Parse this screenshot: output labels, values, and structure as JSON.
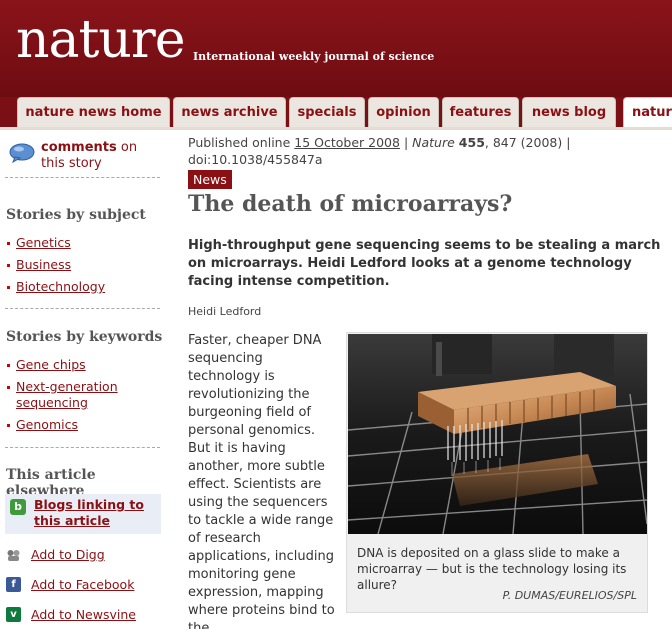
{
  "masthead": {
    "logo": "nature",
    "tagline": "International weekly journal of science"
  },
  "nav": {
    "tabs": [
      "nature news home",
      "news archive",
      "specials",
      "opinion",
      "features",
      "news blog",
      "natur"
    ]
  },
  "sidebar": {
    "comments": {
      "strong": "comments",
      "rest": " on this story"
    },
    "stories_by_subject": {
      "heading": "Stories by subject",
      "items": [
        "Genetics",
        "Business",
        "Biotechnology"
      ]
    },
    "stories_by_keywords": {
      "heading": "Stories by keywords",
      "items": [
        "Gene chips",
        "Next-generation sequencing",
        "Genomics"
      ]
    },
    "elsewhere": {
      "heading": "This article elsewhere",
      "blogs_link": "Blogs linking to this article",
      "share": [
        "Add to Digg",
        "Add to Facebook",
        "Add to Newsvine"
      ]
    }
  },
  "article": {
    "pub_prefix": "Published online ",
    "pub_date": "15 October 2008",
    "pub_sep": " | ",
    "journal": "Nature",
    "volume": "455",
    "pages": ", 847 (2008) |",
    "doi": "doi:10.1038/455847a",
    "badge": "News",
    "headline": "The death of microarrays?",
    "standfirst": "High-throughput gene sequencing seems to be stealing a march on microarrays. Heidi Ledford looks at a genome technology facing intense competition.",
    "byline": "Heidi Ledford",
    "body": "Faster, cheaper DNA sequencing technology is revolutionizing the burgeoning field of personal genomics. But it is having another, more subtle effect. Scientists are using the sequencers to tackle a wide range of research applications, including monitoring gene expression, mapping where proteins bind to the"
  },
  "figure": {
    "caption": "DNA is deposited on a glass slide to make a microarray — but is the technology losing its allure?",
    "credit": "P. DUMAS/EURELIOS/SPL"
  },
  "colors": {
    "brand": "#7a0f15",
    "link": "#8b1014"
  }
}
